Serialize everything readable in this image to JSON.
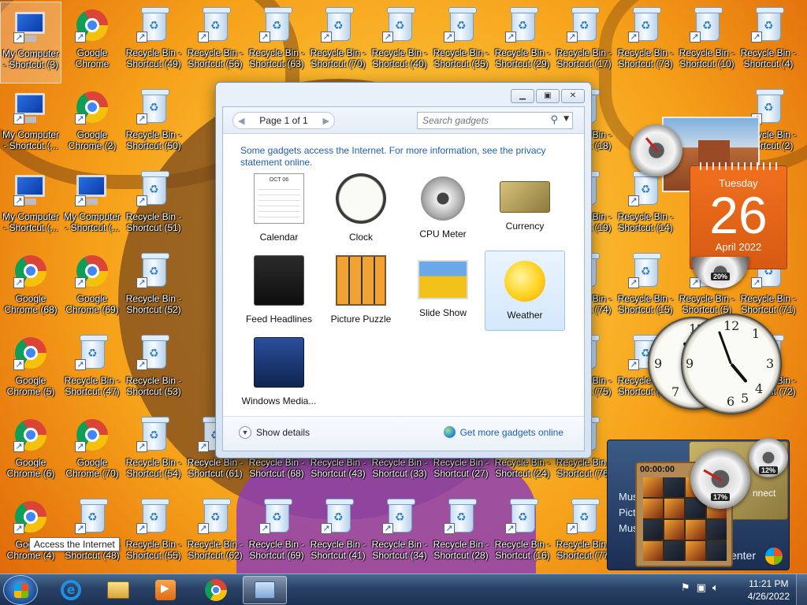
{
  "desktop": {
    "icons": [
      {
        "label": "My Computer - Shortcut (3)",
        "kind": "computer",
        "selected": true
      },
      {
        "label": "Google Chrome",
        "kind": "chrome"
      },
      {
        "label": "Recycle Bin - Shortcut (49)",
        "kind": "bin"
      },
      {
        "label": "Recycle Bin - Shortcut (56)",
        "kind": "bin"
      },
      {
        "label": "Recycle Bin - Shortcut (63)",
        "kind": "bin"
      },
      {
        "label": "Recycle Bin - Shortcut (70)",
        "kind": "bin"
      },
      {
        "label": "Recycle Bin - Shortcut (40)",
        "kind": "bin"
      },
      {
        "label": "Recycle Bin - Shortcut (35)",
        "kind": "bin"
      },
      {
        "label": "Recycle Bin - Shortcut (29)",
        "kind": "bin"
      },
      {
        "label": "Recycle Bin - Shortcut (17)",
        "kind": "bin"
      },
      {
        "label": "Recycle Bin - Shortcut (73)",
        "kind": "bin"
      },
      {
        "label": "Recycle Bin - Shortcut (10)",
        "kind": "bin"
      },
      {
        "label": "Recycle Bin - Shortcut (4)",
        "kind": "bin"
      },
      {
        "label": "My Computer - Shortcut (...",
        "kind": "computer"
      },
      {
        "label": "Google Chrome (2)",
        "kind": "chrome"
      },
      {
        "label": "Recycle Bin - Shortcut (50)",
        "kind": "bin"
      },
      {
        "label": "Recycle Bin - Shortcut (18)",
        "kind": "bin"
      },
      {
        "label": "Recycle Bin - Shortcut (2)",
        "kind": "bin"
      },
      {
        "label": "My Computer - Shortcut (...",
        "kind": "computer"
      },
      {
        "label": "My Computer - Shortcut (...",
        "kind": "computer"
      },
      {
        "label": "Recycle Bin - Shortcut (51)",
        "kind": "bin"
      },
      {
        "label": "Recycle Bin - Shortcut (19)",
        "kind": "bin"
      },
      {
        "label": "Recycle Bin - Shortcut (14)",
        "kind": "bin"
      },
      {
        "label": "Google Chrome (68)",
        "kind": "chrome"
      },
      {
        "label": "Google Chrome (69)",
        "kind": "chrome"
      },
      {
        "label": "Recycle Bin - Shortcut (52)",
        "kind": "bin"
      },
      {
        "label": "Recycle Bin - Shortcut (74)",
        "kind": "bin"
      },
      {
        "label": "Recycle Bin - Shortcut (15)",
        "kind": "bin"
      },
      {
        "label": "Recycle Bin - Shortcut (5)",
        "kind": "bin"
      },
      {
        "label": "Recycle Bin - Shortcut (71)",
        "kind": "bin"
      },
      {
        "label": "Google Chrome (5)",
        "kind": "chrome"
      },
      {
        "label": "Recycle Bin - Shortcut (47)",
        "kind": "bin"
      },
      {
        "label": "Recycle Bin - Shortcut (53)",
        "kind": "bin"
      },
      {
        "label": "Recycle Bin - Shortcut (75)",
        "kind": "bin"
      },
      {
        "label": "Recycle Bin - Shortcut (16)",
        "kind": "bin"
      },
      {
        "label": "Recycle Bin - Shortcut (72)",
        "kind": "bin"
      },
      {
        "label": "Google Chrome (6)",
        "kind": "chrome"
      },
      {
        "label": "Google Chrome (70)",
        "kind": "chrome"
      },
      {
        "label": "Recycle Bin - Shortcut (54)",
        "kind": "bin"
      },
      {
        "label": "Recycle Bin - Shortcut (61)",
        "kind": "bin"
      },
      {
        "label": "Recycle Bin - Shortcut (68)",
        "kind": "bin"
      },
      {
        "label": "Recycle Bin - Shortcut (43)",
        "kind": "bin"
      },
      {
        "label": "Recycle Bin - Shortcut (33)",
        "kind": "bin"
      },
      {
        "label": "Recycle Bin - Shortcut (27)",
        "kind": "bin"
      },
      {
        "label": "Recycle Bin - Shortcut (24)",
        "kind": "bin"
      },
      {
        "label": "Recycle Bin - Shortcut (76)",
        "kind": "bin"
      },
      {
        "label": "Google Chrome (4)",
        "kind": "chrome"
      },
      {
        "label": "Recycle Bin - Shortcut (48)",
        "kind": "bin"
      },
      {
        "label": "Recycle Bin - Shortcut (55)",
        "kind": "bin"
      },
      {
        "label": "Recycle Bin - Shortcut (62)",
        "kind": "bin"
      },
      {
        "label": "Recycle Bin - Shortcut (69)",
        "kind": "bin"
      },
      {
        "label": "Recycle Bin - Shortcut (41)",
        "kind": "bin"
      },
      {
        "label": "Recycle Bin - Shortcut (34)",
        "kind": "bin"
      },
      {
        "label": "Recycle Bin - Shortcut (28)",
        "kind": "bin"
      },
      {
        "label": "Recycle Bin - Shortcut (16)",
        "kind": "bin"
      },
      {
        "label": "Recycle Bin - Shortcut (77)",
        "kind": "bin"
      }
    ],
    "tooltip": "Access the Internet"
  },
  "gallery": {
    "window_buttons": {
      "minimize": "▁",
      "restore": "▣",
      "close": "✕"
    },
    "pager": {
      "prev": "◀",
      "text": "Page 1 of 1",
      "next": "▶"
    },
    "search": {
      "placeholder": "Search gadgets",
      "icon": "search-icon",
      "dropdown": "▼"
    },
    "notice": "Some gadgets access the Internet.  For more information, see the privacy statement online.",
    "gadgets": [
      {
        "label": "Calendar",
        "icon": "calendar-icon"
      },
      {
        "label": "Clock",
        "icon": "clock-icon"
      },
      {
        "label": "CPU Meter",
        "icon": "cpu-meter-icon"
      },
      {
        "label": "Currency",
        "icon": "currency-icon"
      },
      {
        "label": "Feed Headlines",
        "icon": "feed-headlines-icon"
      },
      {
        "label": "Picture Puzzle",
        "icon": "picture-puzzle-icon"
      },
      {
        "label": "Slide Show",
        "icon": "slide-show-icon"
      },
      {
        "label": "Weather",
        "icon": "weather-icon",
        "selected": true
      },
      {
        "label": "Windows Media...",
        "icon": "windows-media-icon"
      }
    ],
    "calendar_thumb_month": "OCT 06",
    "show_details": "Show details",
    "get_more": "Get more gadgets online"
  },
  "desktop_gadgets": {
    "calendar": {
      "day": "Tuesday",
      "date": "26",
      "month": "April 2022"
    },
    "cpu_meter_small": {
      "percent": "20%"
    },
    "cpu_meter_large": {
      "percent": "17%"
    },
    "cpu_meter_right": {
      "percent": "12%"
    },
    "puzzle": {
      "timer": "00:00:00"
    },
    "media_center": {
      "items": [
        "Music",
        "Pictures",
        "Music"
      ],
      "label": "enter"
    },
    "currency_text": "nnect"
  },
  "taskbar": {
    "time": "11:21 PM",
    "date": "4/26/2022",
    "tray_icons": [
      "network-alert-icon",
      "network-icon",
      "volume-icon"
    ]
  },
  "colors": {
    "taskbar": "#1c3154",
    "accent_link": "#1f5fb0",
    "calendar_orange": "#e0661a"
  }
}
